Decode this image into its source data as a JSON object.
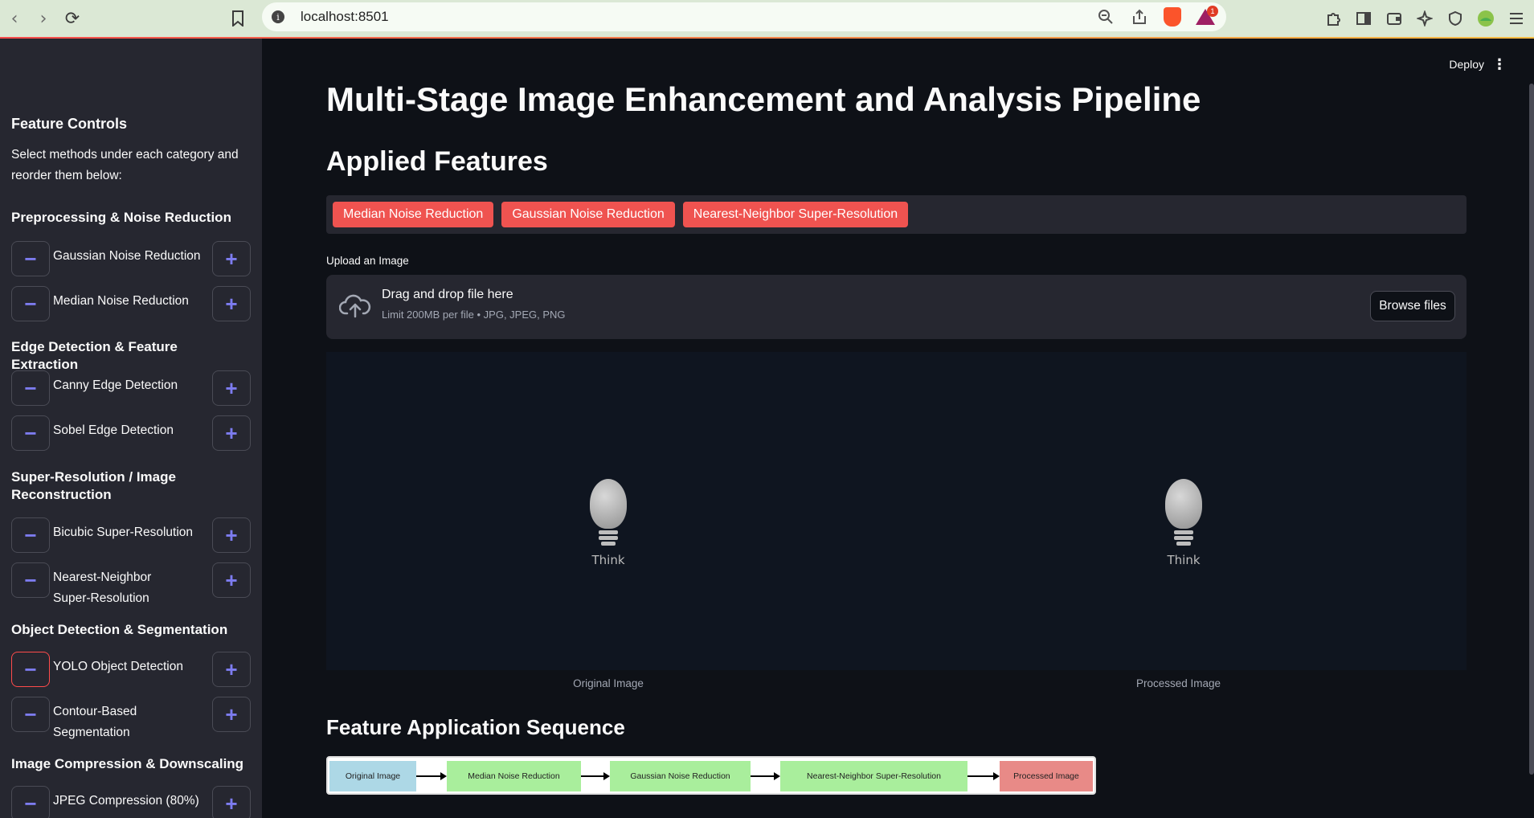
{
  "browser": {
    "url": "localhost:8501",
    "info_glyph": "i",
    "notification_badge": "1"
  },
  "sidebar": {
    "title": "Feature Controls",
    "subtitle": "Select methods under each category and reorder them below:",
    "minus_glyph": "−",
    "plus_glyph": "+",
    "categories": [
      {
        "title": "Preprocessing & Noise Reduction",
        "items": [
          "Gaussian Noise Reduction",
          "Median Noise Reduction"
        ]
      },
      {
        "title": "Edge Detection & Feature Extraction",
        "items": [
          "Canny Edge Detection",
          "Sobel Edge Detection"
        ]
      },
      {
        "title": "Super-Resolution / Image Reconstruction",
        "items": [
          "Bicubic Super-Resolution",
          "Nearest-Neighbor Super-Resolution"
        ]
      },
      {
        "title": "Object Detection & Segmentation",
        "items": [
          "YOLO Object Detection",
          "Contour-Based Segmentation"
        ]
      },
      {
        "title": "Image Compression & Downscaling",
        "items": [
          "JPEG Compression (80%)"
        ]
      }
    ]
  },
  "main": {
    "deploy_label": "Deploy",
    "menu_glyph": "⋮",
    "page_title": "Multi-Stage Image Enhancement and Analysis Pipeline",
    "applied_heading": "Applied Features",
    "applied_tags": [
      "Median Noise Reduction",
      "Gaussian Noise Reduction",
      "Nearest-Neighbor Super-Resolution"
    ],
    "upload": {
      "label": "Upload an Image",
      "drop_title": "Drag and drop file here",
      "limit_text": "Limit 200MB per file • JPG, JPEG, PNG",
      "browse_label": "Browse files"
    },
    "images": {
      "bulb_text": "Think",
      "original_caption": "Original Image",
      "processed_caption": "Processed Image"
    },
    "sequence_heading": "Feature Application Sequence",
    "sequence_nodes": [
      {
        "label": "Original Image",
        "color": "#add8e6"
      },
      {
        "label": "Median Noise Reduction",
        "color": "#a9ee9c"
      },
      {
        "label": "Gaussian Noise Reduction",
        "color": "#a9ee9c"
      },
      {
        "label": "Nearest-Neighbor Super-Resolution",
        "color": "#a9ee9c"
      },
      {
        "label": "Processed Image",
        "color": "#e88a87"
      }
    ]
  },
  "colors": {
    "accent_red": "#ef5350",
    "button_glyph": "#7d7cf0",
    "sidebar_bg": "#262730",
    "app_bg": "#0e1117"
  }
}
